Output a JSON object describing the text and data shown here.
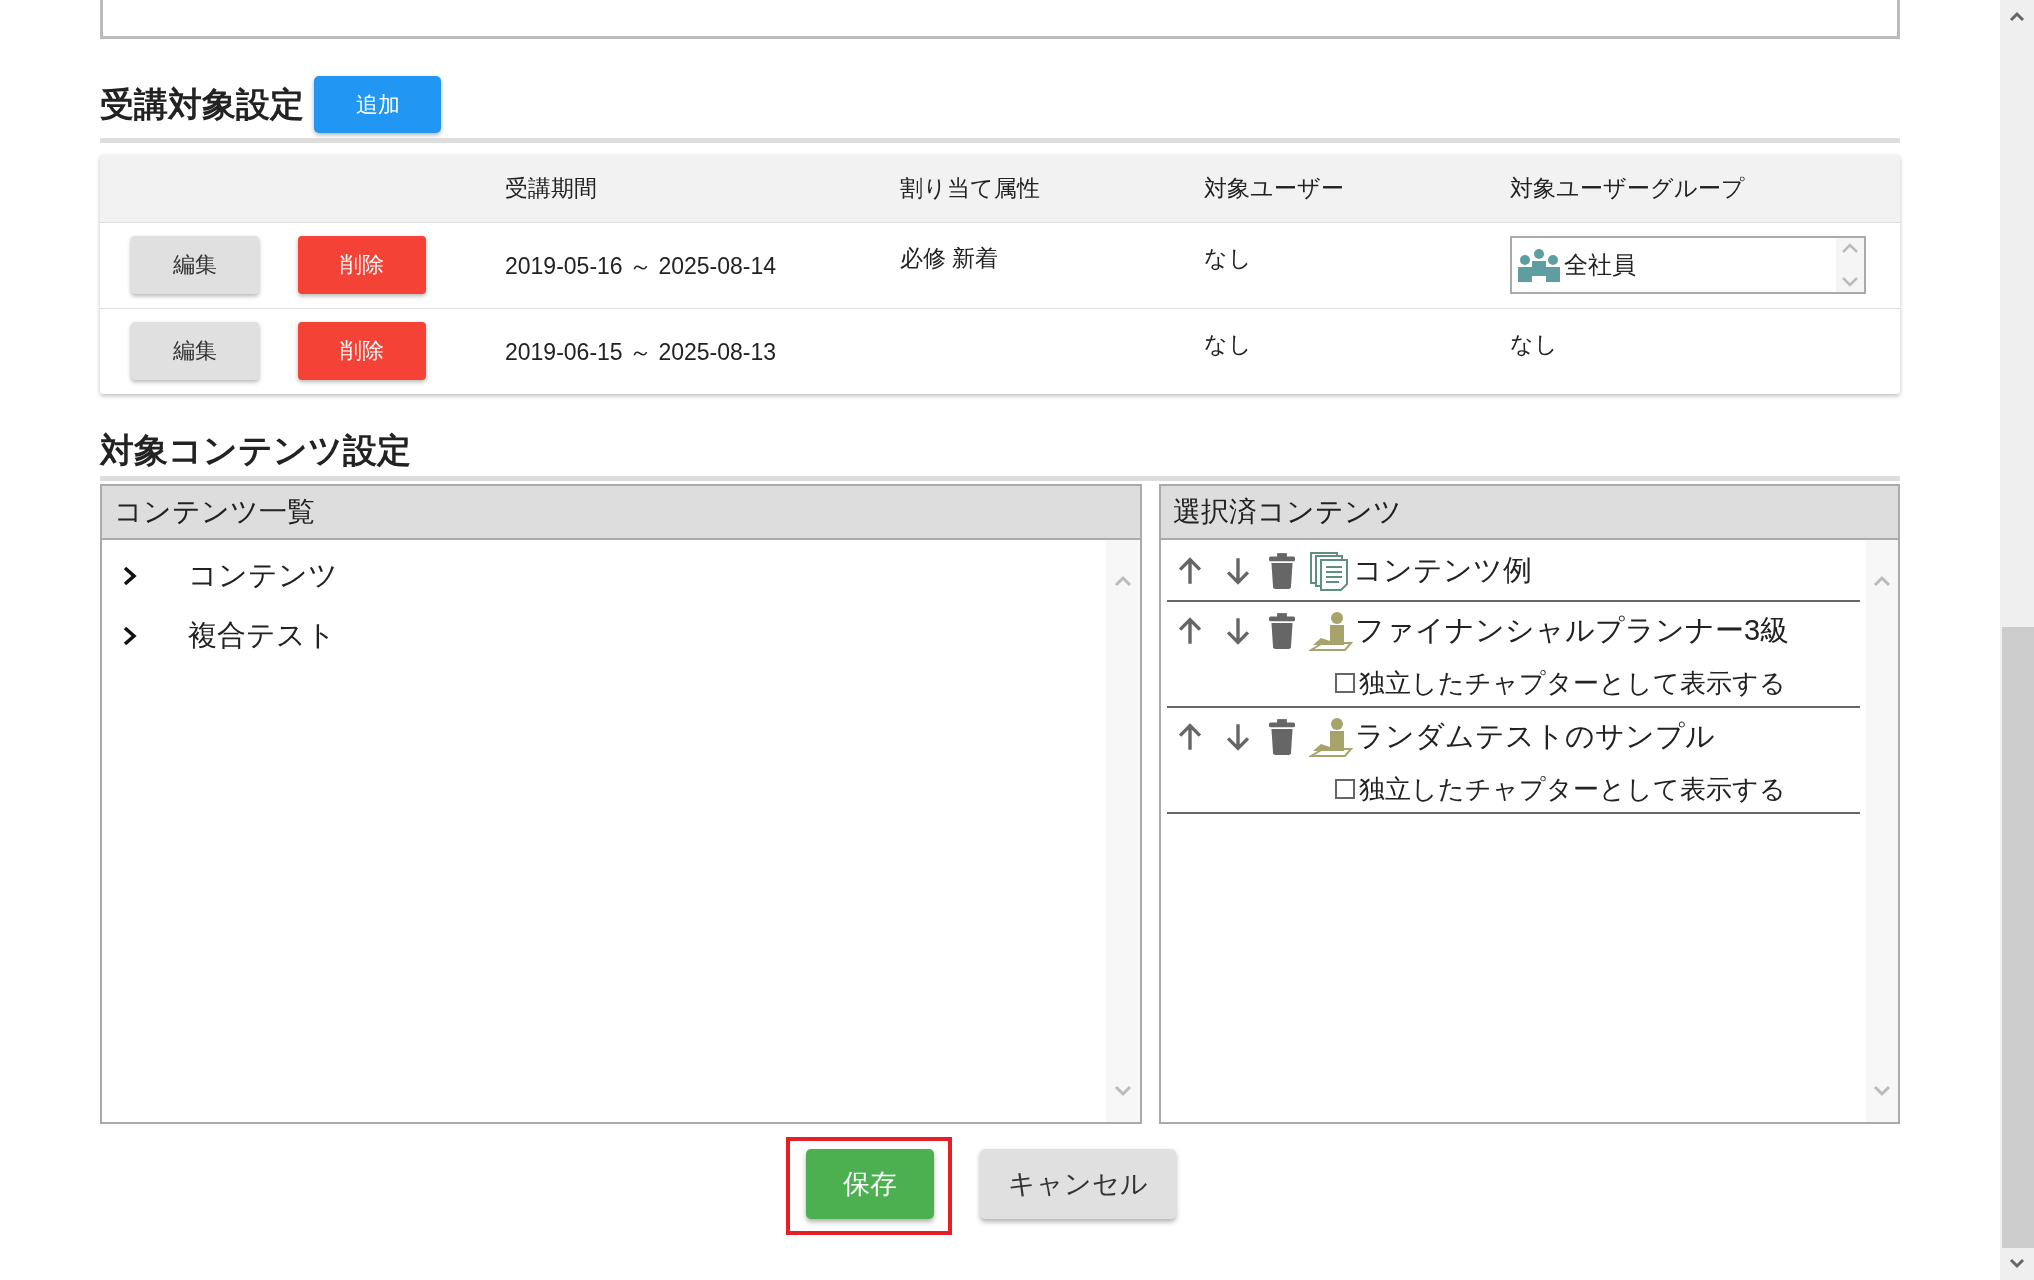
{
  "target_section": {
    "title": "受講対象設定",
    "add_button": "追加"
  },
  "target_table": {
    "columns": [
      "受講期間",
      "割り当て属性",
      "対象ユーザー",
      "対象ユーザーグループ"
    ],
    "rows": [
      {
        "edit": "編集",
        "delete": "削除",
        "period": "2019-05-16 ～ 2025-08-14",
        "attributes": "必修 新着",
        "users": "なし",
        "group": {
          "kind": "list",
          "items": [
            "全社員"
          ]
        }
      },
      {
        "edit": "編集",
        "delete": "削除",
        "period": "2019-06-15 ～ 2025-08-13",
        "users": "なし",
        "group": {
          "kind": "text",
          "text": "なし"
        }
      }
    ]
  },
  "content_section": {
    "title": "対象コンテンツ設定",
    "content_list": {
      "title": "コンテンツ一覧",
      "items": [
        {
          "label": "コンテンツ",
          "expanded": false
        },
        {
          "label": "複合テスト",
          "expanded": false
        }
      ]
    },
    "selected_contents": {
      "title": "選択済コンテンツ",
      "items": [
        {
          "kind": "document",
          "label": "コンテンツ例"
        },
        {
          "kind": "test",
          "label": "ファイナンシャルプランナー3級",
          "chapter_option": {
            "label": "独立したチャプターとして表示する",
            "checked": false
          }
        },
        {
          "kind": "test",
          "label": "ランダムテストのサンプル",
          "chapter_option": {
            "label": "独立したチャプターとして表示する",
            "checked": false
          }
        }
      ]
    }
  },
  "buttons": [
    {
      "kind": "primary",
      "label": "保存",
      "highlighted": true
    },
    {
      "kind": "secondary",
      "label": "キャンセル",
      "highlighted": false
    }
  ]
}
